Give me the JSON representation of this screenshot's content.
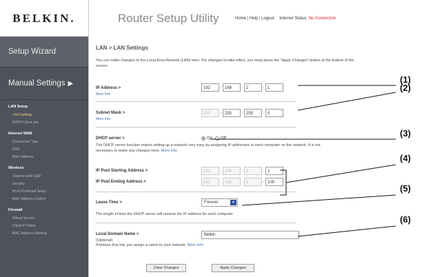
{
  "header": {
    "logo": "BELKIN.",
    "title": "Router Setup Utility",
    "links": [
      "Home",
      "Help",
      "Logout"
    ],
    "internet_status_label": "Internet Status:",
    "internet_status_value": "No Connection"
  },
  "sidebar": {
    "wizard": "Setup Wizard",
    "manual": "Manual Settings",
    "sections": [
      {
        "title": "LAN Setup",
        "items": [
          "LAN Settings",
          "DHCP Client List"
        ]
      },
      {
        "title": "Internet WAN",
        "items": [
          "Connection Type",
          "DNS",
          "MAC Address"
        ]
      },
      {
        "title": "Wireless",
        "items": [
          "Channel and SSID",
          "Security",
          "Wi-Fi Protected Setup",
          "MAC Address Control"
        ]
      },
      {
        "title": "Firewall",
        "items": [
          "Virtual Servers",
          "Client IP Filters",
          "MAC Address Filtering"
        ]
      }
    ]
  },
  "main": {
    "title": "LAN > LAN Settings",
    "intro": "You can make changes to the Local Area Network (LAN) here. For changes to take effect, you must press the \"Apply Changes\" button at the bottom of the screen.",
    "ip_label": "IP Address >",
    "ip": [
      "192",
      "168",
      "2",
      "1"
    ],
    "more_info": "More Info",
    "mask_label": "Subnet Mask >",
    "mask": [
      "255",
      "255",
      "255",
      "0"
    ],
    "dhcp_label": "DHCP server >",
    "dhcp_on": "On",
    "dhcp_off": "Off",
    "dhcp_desc": "The DHCP server function makes setting up a network very easy by assigning IP addresses to each computer on the network. It is not necessary to make any changes here.",
    "pool_start_label": "IP Pool Starting Address >",
    "pool_start": [
      "192",
      "168",
      "2",
      "2"
    ],
    "pool_end_label": "IP Pool Ending Address >",
    "pool_end": [
      "192",
      "168",
      "2",
      "100"
    ],
    "lease_label": "Lease Time >",
    "lease_value": "Forever",
    "lease_desc": "The length of time the DHCP server will reserve the IP address for each computer",
    "domain_label": "Local Domain Name >",
    "domain_optional": "(Optional)",
    "domain_value": "Belkin",
    "domain_desc": "A feature that lets you assign a name to your network.",
    "clear_button": "Clear Changes",
    "apply_button": "Apply Changes"
  },
  "callouts": [
    "(1)",
    "(2)",
    "(3)",
    "(4)",
    "(5)",
    "(6)"
  ]
}
